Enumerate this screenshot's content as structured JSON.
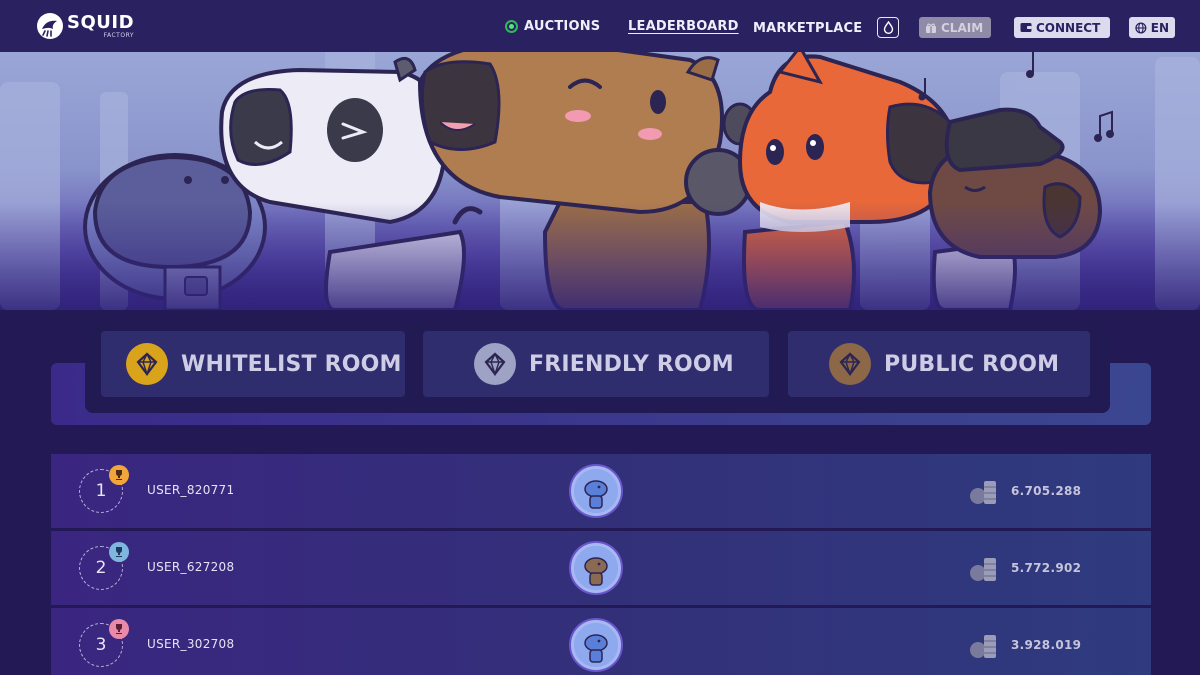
{
  "brand": {
    "name": "SQUID",
    "tagline": "FACTORY"
  },
  "nav": {
    "auctions": "AUCTIONS",
    "leaderboard": "LEADERBOARD",
    "marketplace": "MARKETPLACE",
    "claim": "CLAIM",
    "connect": "CONNECT",
    "language": "EN"
  },
  "status_colors": {
    "live": "#52e47d"
  },
  "rooms": [
    {
      "label": "WHITELIST ROOM",
      "icon": "diamond-badge-icon",
      "color": "#d9a41c"
    },
    {
      "label": "FRIENDLY ROOM",
      "icon": "diamond-badge-icon",
      "color": "#9ea3c6"
    },
    {
      "label": "PUBLIC ROOM",
      "icon": "diamond-badge-icon",
      "color": "#8c6848"
    }
  ],
  "leaderboard": [
    {
      "rank": "1",
      "user": "USER_820771",
      "score": "6.705.288",
      "trophy_color": "#f2a63a"
    },
    {
      "rank": "2",
      "user": "USER_627208",
      "score": "5.772.902",
      "trophy_color": "#7fb6df"
    },
    {
      "rank": "3",
      "user": "USER_302708",
      "score": "3.928.019",
      "trophy_color": "#e88aa8"
    }
  ]
}
